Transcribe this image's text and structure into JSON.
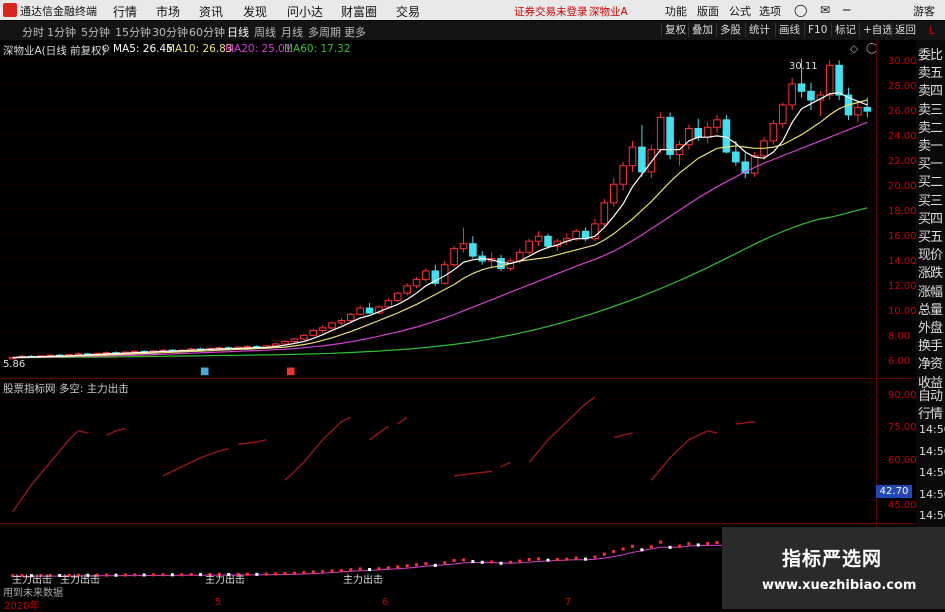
{
  "app": {
    "title": "通达信金融终端",
    "menu": [
      "行情",
      "市场",
      "资讯",
      "发现",
      "问小达",
      "财富圈",
      "交易"
    ],
    "notice": "证券交易未登录",
    "stock_tab": "深物业A",
    "right_menu": [
      "功能",
      "版面",
      "公式",
      "选项"
    ],
    "user": "游客"
  },
  "periods": [
    "分时",
    "1分钟",
    "5分钟",
    "15分钟",
    "30分钟",
    "60分钟",
    "日线",
    "周线",
    "月线",
    "多周期",
    "更多"
  ],
  "active_period": "日线",
  "tools": [
    "复权",
    "叠加",
    "多股",
    "统计",
    "画线",
    "F10",
    "标记",
    "+自选",
    "返回"
  ],
  "ma": {
    "name": "深物业A(日线 前复权)",
    "ma5": "MA5: 26.45",
    "ma10": "MA10: 26.83",
    "ma20": "MA20: 25.01",
    "ma60": "MA60: 17.32"
  },
  "colors": {
    "ma5": "#ffffff",
    "ma10": "#e8e070",
    "ma20": "#d040d0",
    "ma60": "#30c030",
    "up": "#ff3030",
    "down": "#40e0f0"
  },
  "price_axis": [
    "30.00",
    "28.00",
    "26.00",
    "24.00",
    "22.00",
    "20.00",
    "18.00",
    "16.00",
    "14.00",
    "12.00",
    "10.00",
    "8.00",
    "6.00"
  ],
  "annotations": {
    "high": "30.11",
    "low": "5.86"
  },
  "indicator": {
    "title": "股票指标网 多空: 主力出击",
    "axis": [
      "90.00",
      "75.00",
      "60.00",
      "45.00"
    ],
    "last": "42.70"
  },
  "sub_labels": [
    "主力出击",
    "主力出击",
    "主力出击",
    "主力出击"
  ],
  "sub_footer": "用到未来数据",
  "x_ticks": [
    "2020年",
    "5",
    "6",
    "7"
  ],
  "sidebar_top": [
    "委比",
    "卖五",
    "卖四",
    "卖三",
    "卖二",
    "卖一",
    "买一",
    "买二",
    "买三",
    "买四",
    "买五",
    "现价",
    "涨跌",
    "涨幅",
    "总量",
    "外盘",
    "换手",
    "净资",
    "收益"
  ],
  "sidebar_mid": [
    "自动",
    "行情"
  ],
  "sidebar_times": [
    "14:50",
    "14:50",
    "14:50",
    "14:50",
    "14:50",
    "14:50",
    "14:50",
    "14:50"
  ],
  "watermark": {
    "cn": "指标严选网",
    "url": "www.xuezhibiao.com"
  },
  "chart_data": {
    "type": "candlestick",
    "ylim": [
      5,
      31
    ],
    "candles": [
      [
        5.9,
        6.1,
        5.86,
        6.0
      ],
      [
        6.0,
        6.2,
        5.9,
        6.1
      ],
      [
        6.1,
        6.2,
        6.0,
        6.05
      ],
      [
        6.05,
        6.2,
        6.0,
        6.15
      ],
      [
        6.15,
        6.3,
        6.1,
        6.2
      ],
      [
        6.2,
        6.3,
        6.1,
        6.15
      ],
      [
        6.15,
        6.3,
        6.1,
        6.25
      ],
      [
        6.25,
        6.4,
        6.2,
        6.3
      ],
      [
        6.3,
        6.4,
        6.2,
        6.25
      ],
      [
        6.25,
        6.4,
        6.2,
        6.35
      ],
      [
        6.35,
        6.5,
        6.3,
        6.4
      ],
      [
        6.4,
        6.5,
        6.3,
        6.35
      ],
      [
        6.35,
        6.5,
        6.3,
        6.45
      ],
      [
        6.45,
        6.6,
        6.4,
        6.5
      ],
      [
        6.5,
        6.6,
        6.4,
        6.45
      ],
      [
        6.45,
        6.6,
        6.4,
        6.55
      ],
      [
        6.55,
        6.7,
        6.5,
        6.6
      ],
      [
        6.6,
        6.7,
        6.5,
        6.55
      ],
      [
        6.55,
        6.7,
        6.5,
        6.6
      ],
      [
        6.6,
        6.8,
        6.5,
        6.7
      ],
      [
        6.7,
        6.8,
        6.6,
        6.65
      ],
      [
        6.65,
        6.8,
        6.6,
        6.75
      ],
      [
        6.75,
        6.9,
        6.7,
        6.8
      ],
      [
        6.8,
        6.9,
        6.7,
        6.7
      ],
      [
        6.7,
        6.9,
        6.6,
        6.85
      ],
      [
        6.85,
        7.0,
        6.8,
        6.9
      ],
      [
        6.9,
        7.0,
        6.8,
        6.8
      ],
      [
        6.8,
        7.0,
        6.7,
        6.95
      ],
      [
        6.95,
        7.2,
        6.9,
        7.1
      ],
      [
        7.1,
        7.4,
        7.0,
        7.3
      ],
      [
        7.3,
        7.6,
        7.2,
        7.5
      ],
      [
        7.5,
        7.9,
        7.4,
        7.8
      ],
      [
        7.8,
        8.3,
        7.7,
        8.2
      ],
      [
        8.2,
        8.6,
        8.0,
        8.4
      ],
      [
        8.4,
        8.9,
        8.3,
        8.8
      ],
      [
        8.8,
        9.2,
        8.6,
        9.0
      ],
      [
        9.0,
        9.6,
        8.9,
        9.5
      ],
      [
        9.5,
        10.2,
        9.4,
        10.0
      ],
      [
        10.0,
        10.4,
        9.5,
        9.6
      ],
      [
        9.6,
        10.2,
        9.5,
        10.1
      ],
      [
        10.1,
        10.8,
        10.0,
        10.6
      ],
      [
        10.6,
        11.3,
        10.5,
        11.2
      ],
      [
        11.2,
        12.0,
        11.0,
        11.8
      ],
      [
        11.8,
        12.5,
        11.6,
        12.3
      ],
      [
        12.3,
        13.2,
        12.1,
        13.0
      ],
      [
        13.0,
        13.5,
        11.8,
        12.0
      ],
      [
        12.0,
        13.8,
        11.9,
        13.5
      ],
      [
        13.5,
        15.0,
        13.3,
        14.8
      ],
      [
        14.8,
        16.5,
        14.5,
        15.2
      ],
      [
        15.2,
        15.8,
        14.0,
        14.2
      ],
      [
        14.2,
        14.6,
        13.5,
        13.8
      ],
      [
        13.8,
        14.5,
        13.2,
        14.0
      ],
      [
        14.0,
        14.3,
        13.0,
        13.2
      ],
      [
        13.2,
        14.0,
        13.0,
        13.8
      ],
      [
        13.8,
        14.8,
        13.6,
        14.5
      ],
      [
        14.5,
        15.6,
        14.3,
        15.4
      ],
      [
        15.4,
        16.2,
        15.0,
        15.8
      ],
      [
        15.8,
        16.0,
        14.8,
        15.0
      ],
      [
        15.0,
        15.6,
        14.6,
        15.4
      ],
      [
        15.4,
        16.0,
        15.1,
        15.6
      ],
      [
        15.6,
        16.4,
        15.4,
        16.2
      ],
      [
        16.2,
        16.5,
        15.4,
        15.6
      ],
      [
        15.6,
        17.2,
        15.4,
        16.8
      ],
      [
        16.8,
        18.8,
        16.6,
        18.5
      ],
      [
        18.5,
        20.5,
        18.2,
        20.0
      ],
      [
        20.0,
        21.8,
        19.5,
        21.5
      ],
      [
        21.5,
        23.5,
        21.0,
        23.0
      ],
      [
        23.0,
        24.8,
        20.6,
        21.0
      ],
      [
        21.0,
        23.2,
        20.5,
        22.8
      ],
      [
        22.8,
        25.8,
        22.5,
        25.4
      ],
      [
        25.4,
        25.8,
        22.0,
        22.4
      ],
      [
        22.4,
        23.5,
        21.5,
        23.2
      ],
      [
        23.2,
        24.8,
        22.8,
        24.5
      ],
      [
        24.5,
        25.3,
        23.5,
        23.8
      ],
      [
        23.8,
        25.0,
        23.3,
        24.6
      ],
      [
        24.6,
        25.6,
        24.2,
        25.2
      ],
      [
        25.2,
        25.6,
        22.5,
        22.6
      ],
      [
        22.6,
        23.5,
        21.5,
        21.8
      ],
      [
        21.8,
        22.5,
        20.5,
        20.9
      ],
      [
        20.9,
        22.6,
        20.6,
        22.3
      ],
      [
        22.3,
        23.8,
        22.0,
        23.5
      ],
      [
        23.5,
        25.2,
        23.2,
        24.9
      ],
      [
        24.9,
        26.6,
        24.5,
        26.4
      ],
      [
        26.4,
        28.6,
        26.0,
        28.1
      ],
      [
        28.1,
        30.11,
        27.0,
        27.5
      ],
      [
        27.5,
        28.2,
        26.0,
        26.8
      ],
      [
        26.8,
        27.5,
        25.5,
        27.2
      ],
      [
        27.2,
        30.0,
        26.8,
        29.6
      ],
      [
        29.6,
        30.0,
        26.8,
        27.2
      ],
      [
        27.2,
        27.8,
        25.2,
        25.6
      ],
      [
        25.6,
        26.6,
        25.0,
        26.2
      ],
      [
        26.2,
        27.0,
        25.4,
        25.9
      ]
    ],
    "ma5": [
      6.0,
      6.05,
      6.06,
      6.08,
      6.1,
      6.13,
      6.15,
      6.18,
      6.22,
      6.25,
      6.3,
      6.33,
      6.36,
      6.4,
      6.43,
      6.46,
      6.5,
      6.53,
      6.56,
      6.6,
      6.63,
      6.66,
      6.7,
      6.72,
      6.75,
      6.78,
      6.8,
      6.83,
      6.9,
      7.0,
      7.15,
      7.3,
      7.55,
      7.85,
      8.2,
      8.5,
      8.85,
      9.2,
      9.4,
      9.7,
      10.0,
      10.3,
      10.7,
      11.2,
      11.8,
      12.2,
      12.6,
      13.1,
      13.7,
      13.9,
      14.0,
      13.9,
      13.7,
      13.6,
      13.8,
      14.2,
      14.6,
      14.9,
      15.1,
      15.4,
      15.6,
      15.6,
      15.8,
      16.5,
      17.4,
      18.4,
      19.8,
      20.8,
      21.8,
      22.8,
      22.8,
      22.8,
      23.5,
      23.8,
      23.8,
      23.9,
      23.8,
      23.3,
      22.6,
      22.2,
      22.1,
      22.6,
      23.5,
      25.0,
      26.1,
      26.5,
      26.9,
      27.3,
      27.4,
      27.0,
      26.7,
      26.4
    ],
    "ma10": [
      6.0,
      6.02,
      6.04,
      6.05,
      6.07,
      6.09,
      6.11,
      6.13,
      6.15,
      6.18,
      6.21,
      6.24,
      6.27,
      6.3,
      6.33,
      6.36,
      6.4,
      6.43,
      6.46,
      6.5,
      6.53,
      6.56,
      6.6,
      6.63,
      6.66,
      6.69,
      6.72,
      6.75,
      6.8,
      6.85,
      6.95,
      7.05,
      7.2,
      7.4,
      7.6,
      7.85,
      8.1,
      8.4,
      8.7,
      9.0,
      9.3,
      9.6,
      9.95,
      10.3,
      10.7,
      11.1,
      11.5,
      11.9,
      12.4,
      12.8,
      13.1,
      13.3,
      13.4,
      13.6,
      13.8,
      13.9,
      14.0,
      14.1,
      14.3,
      14.5,
      14.7,
      14.9,
      15.1,
      15.5,
      16.0,
      16.6,
      17.2,
      17.9,
      18.6,
      19.4,
      20.2,
      20.9,
      21.5,
      22.1,
      22.5,
      22.9,
      23.0,
      23.1,
      23.0,
      22.9,
      22.9,
      23.0,
      23.2,
      23.6,
      24.0,
      24.5,
      25.0,
      25.6,
      26.1,
      26.4,
      26.6,
      26.8
    ],
    "ma20": [
      6.0,
      6.01,
      6.02,
      6.03,
      6.04,
      6.06,
      6.07,
      6.09,
      6.1,
      6.12,
      6.14,
      6.16,
      6.18,
      6.2,
      6.22,
      6.24,
      6.27,
      6.3,
      6.33,
      6.36,
      6.39,
      6.42,
      6.45,
      6.48,
      6.51,
      6.54,
      6.57,
      6.6,
      6.64,
      6.68,
      6.73,
      6.8,
      6.87,
      6.95,
      7.05,
      7.15,
      7.28,
      7.42,
      7.57,
      7.73,
      7.9,
      8.08,
      8.27,
      8.47,
      8.7,
      8.94,
      9.2,
      9.48,
      9.78,
      10.08,
      10.38,
      10.68,
      10.98,
      11.28,
      11.58,
      11.88,
      12.18,
      12.48,
      12.78,
      13.08,
      13.38,
      13.66,
      13.94,
      14.25,
      14.6,
      15.0,
      15.45,
      15.9,
      16.4,
      16.9,
      17.4,
      17.9,
      18.4,
      18.9,
      19.35,
      19.8,
      20.2,
      20.6,
      21.0,
      21.35,
      21.7,
      22.0,
      22.3,
      22.6,
      22.9,
      23.2,
      23.5,
      23.8,
      24.1,
      24.4,
      24.7,
      25.0
    ],
    "ma60": [
      6.0,
      6.0,
      6.0,
      6.01,
      6.01,
      6.02,
      6.02,
      6.03,
      6.03,
      6.04,
      6.05,
      6.06,
      6.07,
      6.08,
      6.09,
      6.1,
      6.11,
      6.12,
      6.13,
      6.14,
      6.15,
      6.16,
      6.17,
      6.18,
      6.19,
      6.2,
      6.21,
      6.22,
      6.23,
      6.24,
      6.26,
      6.28,
      6.3,
      6.32,
      6.35,
      6.38,
      6.41,
      6.45,
      6.49,
      6.53,
      6.58,
      6.63,
      6.69,
      6.75,
      6.82,
      6.9,
      6.98,
      7.07,
      7.17,
      7.28,
      7.4,
      7.53,
      7.67,
      7.82,
      7.98,
      8.15,
      8.33,
      8.52,
      8.72,
      8.93,
      9.15,
      9.38,
      9.62,
      9.87,
      10.13,
      10.4,
      10.68,
      10.97,
      11.27,
      11.58,
      11.9,
      12.23,
      12.57,
      12.92,
      13.28,
      13.65,
      14.02,
      14.4,
      14.78,
      15.16,
      15.52,
      15.86,
      16.18,
      16.48,
      16.76,
      17.0,
      17.2,
      17.32,
      17.5,
      17.7,
      17.9,
      18.1
    ],
    "indicator_segments": [
      [
        [
          0,
          40
        ],
        [
          2,
          52
        ],
        [
          4,
          62
        ],
        [
          6,
          72
        ],
        [
          7,
          76
        ],
        [
          8,
          75
        ]
      ],
      [
        [
          10,
          74
        ],
        [
          11,
          76
        ],
        [
          12,
          77
        ]
      ],
      [
        [
          16,
          56
        ],
        [
          18,
          60
        ],
        [
          20,
          64
        ],
        [
          22,
          67
        ],
        [
          23,
          68
        ]
      ],
      [
        [
          24,
          70
        ],
        [
          26,
          71
        ],
        [
          27,
          72
        ]
      ],
      [
        [
          29,
          54
        ],
        [
          31,
          62
        ],
        [
          33,
          72
        ],
        [
          35,
          80
        ],
        [
          36,
          82
        ]
      ],
      [
        [
          38,
          72
        ],
        [
          40,
          78
        ]
      ],
      [
        [
          41,
          79
        ],
        [
          42,
          82
        ]
      ],
      [
        [
          47,
          56
        ],
        [
          49,
          57
        ],
        [
          51,
          58
        ]
      ],
      [
        [
          52,
          60
        ],
        [
          53,
          62
        ]
      ],
      [
        [
          55,
          62
        ],
        [
          57,
          72
        ],
        [
          59,
          80
        ],
        [
          61,
          88
        ],
        [
          62,
          91
        ]
      ],
      [
        [
          64,
          73
        ],
        [
          66,
          75
        ]
      ],
      [
        [
          68,
          54
        ],
        [
          70,
          64
        ],
        [
          72,
          72
        ],
        [
          74,
          76
        ],
        [
          75,
          75
        ]
      ],
      [
        [
          77,
          79
        ],
        [
          79,
          80
        ]
      ]
    ]
  }
}
